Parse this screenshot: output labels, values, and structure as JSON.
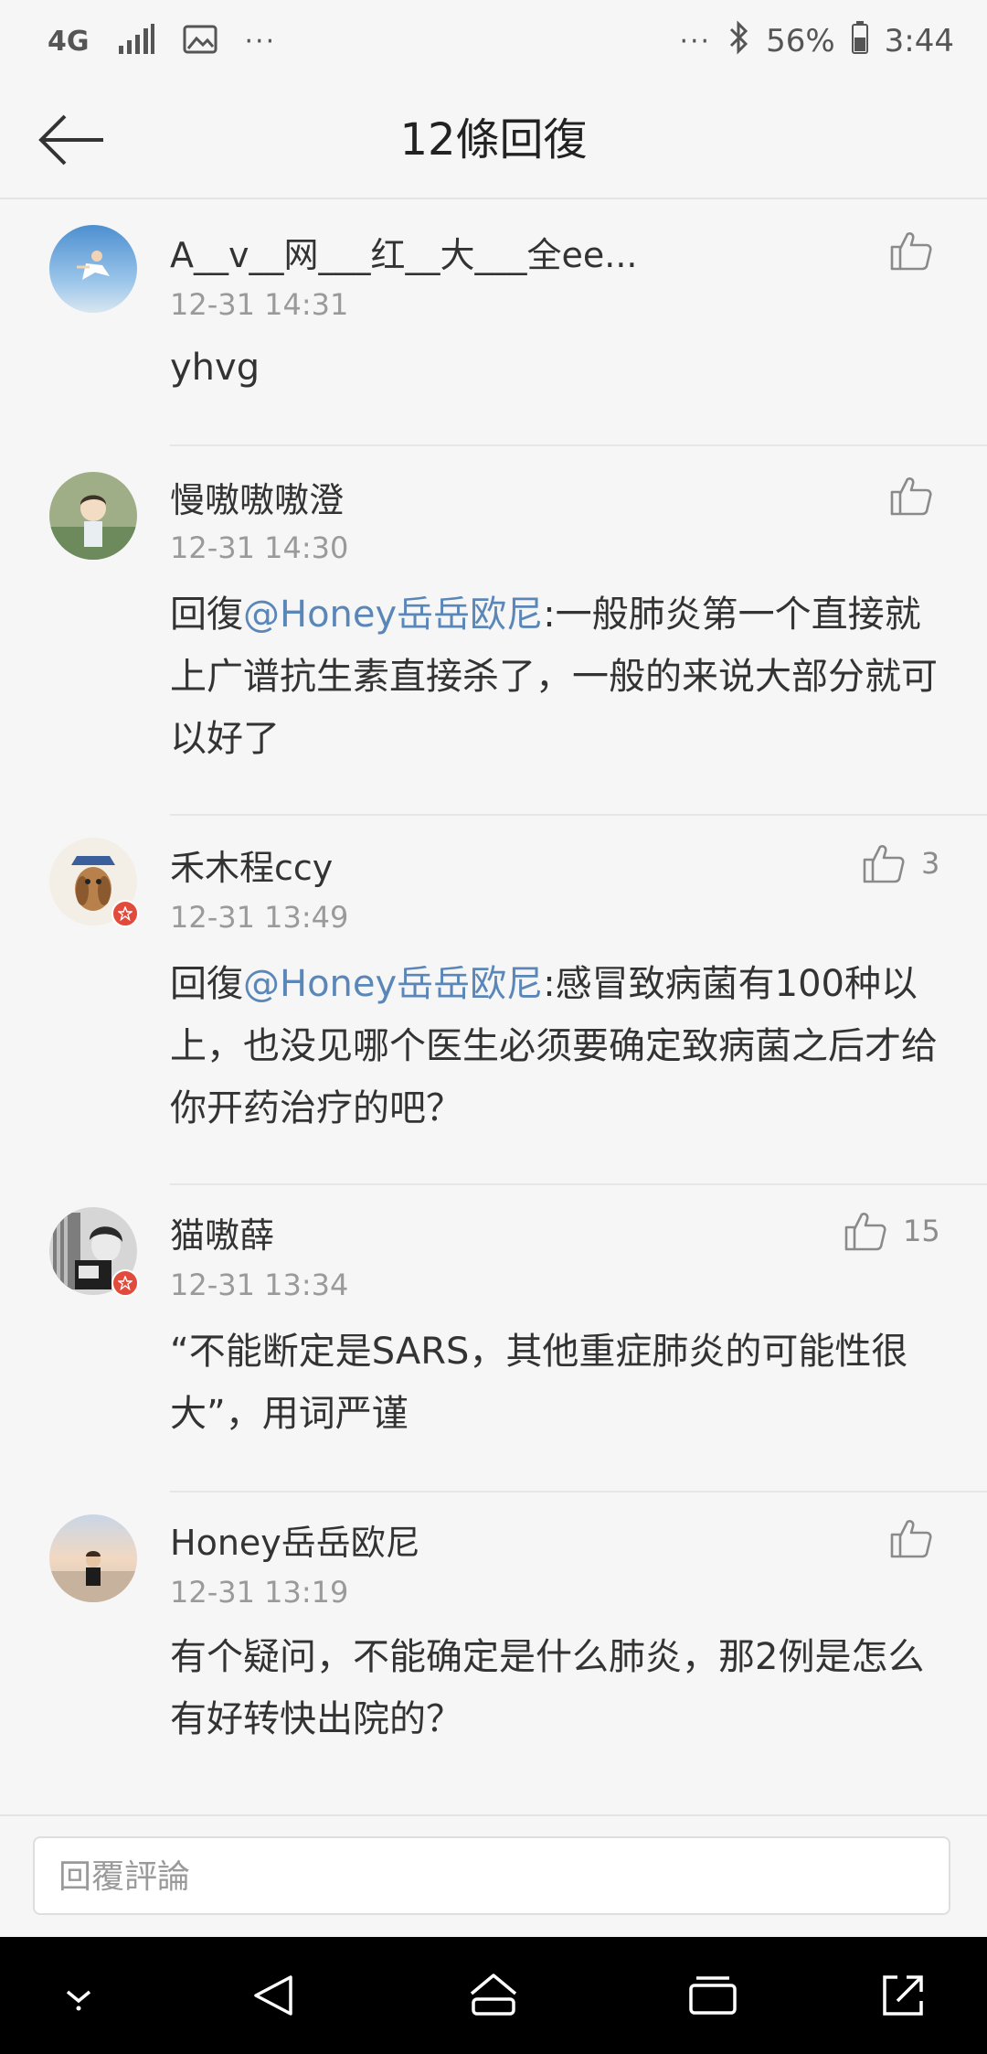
{
  "status_bar": {
    "network": "4G",
    "more_left": "···",
    "more_right": "···",
    "battery": "56%",
    "time": "3:44"
  },
  "header": {
    "title": "12條回復"
  },
  "comments": [
    {
      "name": "A__v__网___红__大___全ee...",
      "time": "12-31 14:31",
      "body": [
        {
          "t": "text",
          "v": "yhvg"
        }
      ],
      "likes": "",
      "verified": false
    },
    {
      "name": "慢嗷嗷嗷澄",
      "time": "12-31 14:30",
      "body": [
        {
          "t": "text",
          "v": "回復"
        },
        {
          "t": "mention",
          "v": "@Honey岳岳欧尼"
        },
        {
          "t": "text",
          "v": ":一般肺炎第一个直接就上广谱抗生素直接杀了，一般的来说大部分就可以好了"
        }
      ],
      "likes": "",
      "verified": false
    },
    {
      "name": "禾木程ccy",
      "time": "12-31 13:49",
      "body": [
        {
          "t": "text",
          "v": "回復"
        },
        {
          "t": "mention",
          "v": "@Honey岳岳欧尼"
        },
        {
          "t": "text",
          "v": ":感冒致病菌有100种以上，也没见哪个医生必须要确定致病菌之后才给你开药治疗的吧？"
        }
      ],
      "likes": "3",
      "verified": true
    },
    {
      "name": "猫嗷薛",
      "time": "12-31 13:34",
      "body": [
        {
          "t": "text",
          "v": "“不能断定是SARS，其他重症肺炎的可能性很大”，用词严谨"
        }
      ],
      "likes": "15",
      "verified": true
    },
    {
      "name": "Honey岳岳欧尼",
      "time": "12-31 13:19",
      "body": [
        {
          "t": "text",
          "v": "有个疑问，不能确定是什么肺炎，那2例是怎么有好转快出院的？"
        }
      ],
      "likes": "",
      "verified": false
    }
  ],
  "reply": {
    "placeholder": "回覆評論"
  },
  "colors": {
    "mention": "#5b87b8",
    "badge": "#e24b3b"
  }
}
